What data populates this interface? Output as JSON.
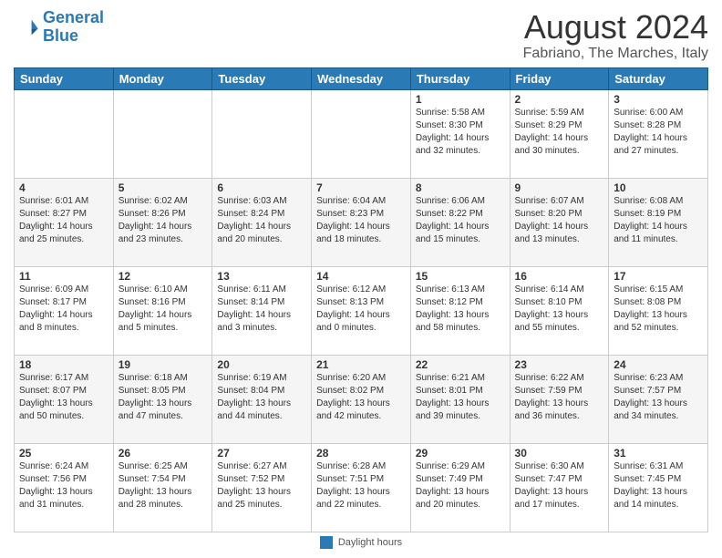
{
  "logo": {
    "line1": "General",
    "line2": "Blue"
  },
  "header": {
    "month_year": "August 2024",
    "location": "Fabriano, The Marches, Italy"
  },
  "days_of_week": [
    "Sunday",
    "Monday",
    "Tuesday",
    "Wednesday",
    "Thursday",
    "Friday",
    "Saturday"
  ],
  "footer": {
    "label": "Daylight hours"
  },
  "weeks": [
    [
      {
        "day": "",
        "info": ""
      },
      {
        "day": "",
        "info": ""
      },
      {
        "day": "",
        "info": ""
      },
      {
        "day": "",
        "info": ""
      },
      {
        "day": "1",
        "info": "Sunrise: 5:58 AM\nSunset: 8:30 PM\nDaylight: 14 hours\nand 32 minutes."
      },
      {
        "day": "2",
        "info": "Sunrise: 5:59 AM\nSunset: 8:29 PM\nDaylight: 14 hours\nand 30 minutes."
      },
      {
        "day": "3",
        "info": "Sunrise: 6:00 AM\nSunset: 8:28 PM\nDaylight: 14 hours\nand 27 minutes."
      }
    ],
    [
      {
        "day": "4",
        "info": "Sunrise: 6:01 AM\nSunset: 8:27 PM\nDaylight: 14 hours\nand 25 minutes."
      },
      {
        "day": "5",
        "info": "Sunrise: 6:02 AM\nSunset: 8:26 PM\nDaylight: 14 hours\nand 23 minutes."
      },
      {
        "day": "6",
        "info": "Sunrise: 6:03 AM\nSunset: 8:24 PM\nDaylight: 14 hours\nand 20 minutes."
      },
      {
        "day": "7",
        "info": "Sunrise: 6:04 AM\nSunset: 8:23 PM\nDaylight: 14 hours\nand 18 minutes."
      },
      {
        "day": "8",
        "info": "Sunrise: 6:06 AM\nSunset: 8:22 PM\nDaylight: 14 hours\nand 15 minutes."
      },
      {
        "day": "9",
        "info": "Sunrise: 6:07 AM\nSunset: 8:20 PM\nDaylight: 14 hours\nand 13 minutes."
      },
      {
        "day": "10",
        "info": "Sunrise: 6:08 AM\nSunset: 8:19 PM\nDaylight: 14 hours\nand 11 minutes."
      }
    ],
    [
      {
        "day": "11",
        "info": "Sunrise: 6:09 AM\nSunset: 8:17 PM\nDaylight: 14 hours\nand 8 minutes."
      },
      {
        "day": "12",
        "info": "Sunrise: 6:10 AM\nSunset: 8:16 PM\nDaylight: 14 hours\nand 5 minutes."
      },
      {
        "day": "13",
        "info": "Sunrise: 6:11 AM\nSunset: 8:14 PM\nDaylight: 14 hours\nand 3 minutes."
      },
      {
        "day": "14",
        "info": "Sunrise: 6:12 AM\nSunset: 8:13 PM\nDaylight: 14 hours\nand 0 minutes."
      },
      {
        "day": "15",
        "info": "Sunrise: 6:13 AM\nSunset: 8:12 PM\nDaylight: 13 hours\nand 58 minutes."
      },
      {
        "day": "16",
        "info": "Sunrise: 6:14 AM\nSunset: 8:10 PM\nDaylight: 13 hours\nand 55 minutes."
      },
      {
        "day": "17",
        "info": "Sunrise: 6:15 AM\nSunset: 8:08 PM\nDaylight: 13 hours\nand 52 minutes."
      }
    ],
    [
      {
        "day": "18",
        "info": "Sunrise: 6:17 AM\nSunset: 8:07 PM\nDaylight: 13 hours\nand 50 minutes."
      },
      {
        "day": "19",
        "info": "Sunrise: 6:18 AM\nSunset: 8:05 PM\nDaylight: 13 hours\nand 47 minutes."
      },
      {
        "day": "20",
        "info": "Sunrise: 6:19 AM\nSunset: 8:04 PM\nDaylight: 13 hours\nand 44 minutes."
      },
      {
        "day": "21",
        "info": "Sunrise: 6:20 AM\nSunset: 8:02 PM\nDaylight: 13 hours\nand 42 minutes."
      },
      {
        "day": "22",
        "info": "Sunrise: 6:21 AM\nSunset: 8:01 PM\nDaylight: 13 hours\nand 39 minutes."
      },
      {
        "day": "23",
        "info": "Sunrise: 6:22 AM\nSunset: 7:59 PM\nDaylight: 13 hours\nand 36 minutes."
      },
      {
        "day": "24",
        "info": "Sunrise: 6:23 AM\nSunset: 7:57 PM\nDaylight: 13 hours\nand 34 minutes."
      }
    ],
    [
      {
        "day": "25",
        "info": "Sunrise: 6:24 AM\nSunset: 7:56 PM\nDaylight: 13 hours\nand 31 minutes."
      },
      {
        "day": "26",
        "info": "Sunrise: 6:25 AM\nSunset: 7:54 PM\nDaylight: 13 hours\nand 28 minutes."
      },
      {
        "day": "27",
        "info": "Sunrise: 6:27 AM\nSunset: 7:52 PM\nDaylight: 13 hours\nand 25 minutes."
      },
      {
        "day": "28",
        "info": "Sunrise: 6:28 AM\nSunset: 7:51 PM\nDaylight: 13 hours\nand 22 minutes."
      },
      {
        "day": "29",
        "info": "Sunrise: 6:29 AM\nSunset: 7:49 PM\nDaylight: 13 hours\nand 20 minutes."
      },
      {
        "day": "30",
        "info": "Sunrise: 6:30 AM\nSunset: 7:47 PM\nDaylight: 13 hours\nand 17 minutes."
      },
      {
        "day": "31",
        "info": "Sunrise: 6:31 AM\nSunset: 7:45 PM\nDaylight: 13 hours\nand 14 minutes."
      }
    ]
  ]
}
